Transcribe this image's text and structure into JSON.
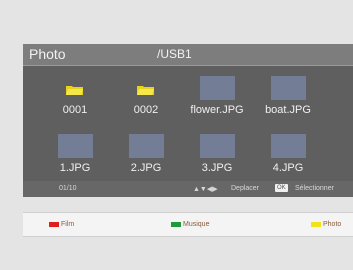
{
  "header": {
    "title": "Photo",
    "path": "/USB1"
  },
  "grid": {
    "items": [
      {
        "label": "0001",
        "icon": "folder-icon"
      },
      {
        "label": "0002",
        "icon": "folder-icon"
      },
      {
        "label": "flower.JPG",
        "icon": "image-thumbnail"
      },
      {
        "label": "boat.JPG",
        "icon": "image-thumbnail"
      },
      {
        "label": "1.JPG",
        "icon": "image-thumbnail"
      },
      {
        "label": "2.JPG",
        "icon": "image-thumbnail"
      },
      {
        "label": "3.JPG",
        "icon": "image-thumbnail"
      },
      {
        "label": "4.JPG",
        "icon": "image-thumbnail"
      }
    ]
  },
  "footer": {
    "count": "01/10",
    "nav_arrows": "▲▼◀▶",
    "move_label": "Deplacer",
    "ok_key": "OK",
    "select_label": "Sélectionner"
  },
  "colorbar": {
    "film": {
      "label": "Film",
      "color": "#e01e1e"
    },
    "music": {
      "label": "Musique",
      "color": "#1f9a3a"
    },
    "photo": {
      "label": "Photo",
      "color": "#f2e21a"
    }
  }
}
